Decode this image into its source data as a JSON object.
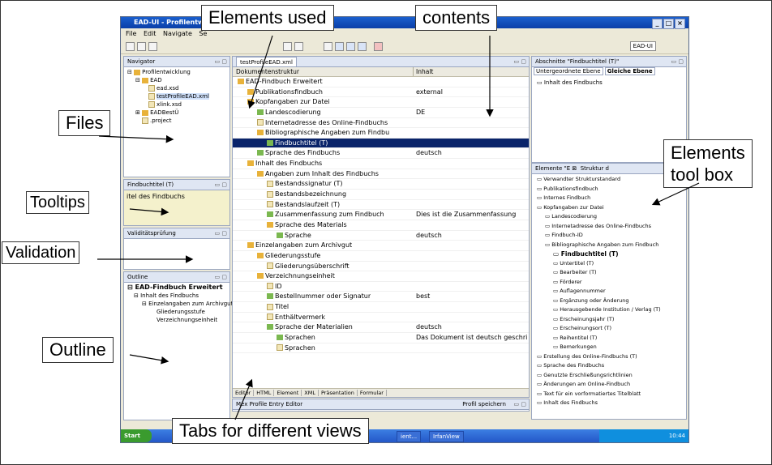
{
  "window": {
    "title": "EAD-UI - Profilentwi...",
    "menu": [
      "File",
      "Edit",
      "Navigate",
      "Se"
    ],
    "perspective_label": "EAD-UI"
  },
  "navigator": {
    "tab": "Navigator",
    "items": [
      "Profilentwicklung",
      "EAD",
      "ead.xsd",
      "testProfileEAD.xml",
      "xlink.xsd",
      "EADBestÜ",
      ".project"
    ]
  },
  "tooltip_panel": {
    "tab": "Findbuchtitel (T)",
    "text": "itel des Findbuchs"
  },
  "validation_panel": {
    "tab": "Validitätsprüfung"
  },
  "outline": {
    "tab": "Outline",
    "items": [
      "EAD-Findbuch Erweitert",
      "Inhalt des Findbuchs",
      "Einzelangaben zum Archivgut",
      "Gliederungsstufe",
      "Verzeichnungseinheit"
    ]
  },
  "editor": {
    "tab": "testProfileEAD.xml",
    "col_structure": "Dokumentenstruktur",
    "col_content": "Inhalt",
    "rows": [
      {
        "name": "EAD-Findbuch Erweitert",
        "value": "",
        "level": 0,
        "icon": "folder"
      },
      {
        "name": "Publikationsfindbuch",
        "value": "external",
        "level": 1,
        "icon": "folder"
      },
      {
        "name": "Kopfangaben zur Datei",
        "value": "",
        "level": 1,
        "icon": "folder"
      },
      {
        "name": "Landescodierung",
        "value": "DE",
        "level": 2,
        "icon": "leaf"
      },
      {
        "name": "Internetadresse des Online-Findbuchs",
        "value": "",
        "level": 2,
        "icon": "page"
      },
      {
        "name": "Bibliographische Angaben zum Findbu",
        "value": "",
        "level": 2,
        "icon": "folder"
      },
      {
        "name": "Findbuchtitel (T)",
        "value": "",
        "level": 3,
        "icon": "leaf",
        "selected": true
      },
      {
        "name": "Sprache des Findbuchs",
        "value": "deutsch",
        "level": 2,
        "icon": "leaf"
      },
      {
        "name": "Inhalt des Findbuchs",
        "value": "",
        "level": 1,
        "icon": "folder"
      },
      {
        "name": "Angaben zum Inhalt des Findbuchs",
        "value": "",
        "level": 2,
        "icon": "folder"
      },
      {
        "name": "Bestandssignatur (T)",
        "value": "",
        "level": 3,
        "icon": "page"
      },
      {
        "name": "Bestandsbezeichnung",
        "value": "",
        "level": 3,
        "icon": "page"
      },
      {
        "name": "Bestandslaufzeit (T)",
        "value": "",
        "level": 3,
        "icon": "page"
      },
      {
        "name": "Zusammenfassung zum Findbuch",
        "value": "Dies ist die Zusammenfassung",
        "level": 3,
        "icon": "leaf"
      },
      {
        "name": "Sprache des Materials",
        "value": "",
        "level": 3,
        "icon": "folder"
      },
      {
        "name": "Sprache",
        "value": "deutsch",
        "level": 4,
        "icon": "leaf"
      },
      {
        "name": "Einzelangaben zum Archivgut",
        "value": "",
        "level": 1,
        "icon": "folder"
      },
      {
        "name": "Gliederungsstufe",
        "value": "",
        "level": 2,
        "icon": "folder"
      },
      {
        "name": "Gliederungsüberschrift",
        "value": "",
        "level": 3,
        "icon": "page"
      },
      {
        "name": "Verzeichnungseinheit",
        "value": "",
        "level": 2,
        "icon": "folder"
      },
      {
        "name": "ID",
        "value": "",
        "level": 3,
        "icon": "page"
      },
      {
        "name": "Bestellnummer oder Signatur",
        "value": "best",
        "level": 3,
        "icon": "leaf"
      },
      {
        "name": "Titel",
        "value": "",
        "level": 3,
        "icon": "page"
      },
      {
        "name": "Enthältvermerk",
        "value": "",
        "level": 3,
        "icon": "page"
      },
      {
        "name": "Sprache der Materialien",
        "value": "deutsch",
        "level": 3,
        "icon": "leaf"
      },
      {
        "name": "Sprachen",
        "value": "Das Dokument ist deutsch geschri",
        "level": 4,
        "icon": "leaf"
      },
      {
        "name": "Sprachen",
        "value": "",
        "level": 4,
        "icon": "page"
      }
    ],
    "bottom_tabs": [
      "Editor",
      "HTML",
      "Element",
      "XML",
      "Präsentation",
      "Formular"
    ]
  },
  "profile_entry": {
    "tab": "Mex Profile Entry Editor",
    "save_label": "Profil speichern"
  },
  "sections_panel": {
    "tab": "Abschnitte \"Findbuchtitel (T)\"",
    "subtabs": [
      "Untergeordnete Ebene",
      "Gleiche Ebene"
    ],
    "items": [
      "Inhalt des Findbuchs"
    ]
  },
  "elements_panel": {
    "tab": "Elemente \"E",
    "tab2": "Struktur d",
    "items": [
      "Verwandter Strukturstandard",
      "Publikationsfindbuch",
      "Internes Findbuch",
      "Kopfangaben zur Datei",
      "Landescodierung",
      "Internetadresse des Online-Findbuchs",
      "Findbuch-ID",
      "Bibliographische Angaben zum Findbuch",
      "Findbuchtitel (T)",
      "Untertitel (T)",
      "Bearbeiter (T)",
      "Förderer",
      "Auflagennummer",
      "Ergänzung oder Änderung",
      "Herausgebende Institution / Verlag (T)",
      "Erscheinungsjahr (T)",
      "Erscheinungsort (T)",
      "Reihentitel (T)",
      "Bemerkungen",
      "Erstellung des Online-Findbuchs (T)",
      "Sprache des Findbuchs",
      "Genutzte Erschließungsrichtlinien",
      "Änderungen am Online-Findbuch",
      "Text für ein vorformatiertes Titelblatt",
      "Inhalt des Findbuchs"
    ]
  },
  "taskbar": {
    "start": "Start",
    "item1": "ient...",
    "item2": "IrfanView",
    "clock": "10:44"
  },
  "callouts": {
    "elements_used": "Elements used",
    "contents": "contents",
    "files": "Files",
    "elements_toolbox_line1": "Elements",
    "elements_toolbox_line2": "tool box",
    "tooltips": "Tooltips",
    "validation": "Validation",
    "outline": "Outline",
    "tabs": "Tabs for different views"
  }
}
